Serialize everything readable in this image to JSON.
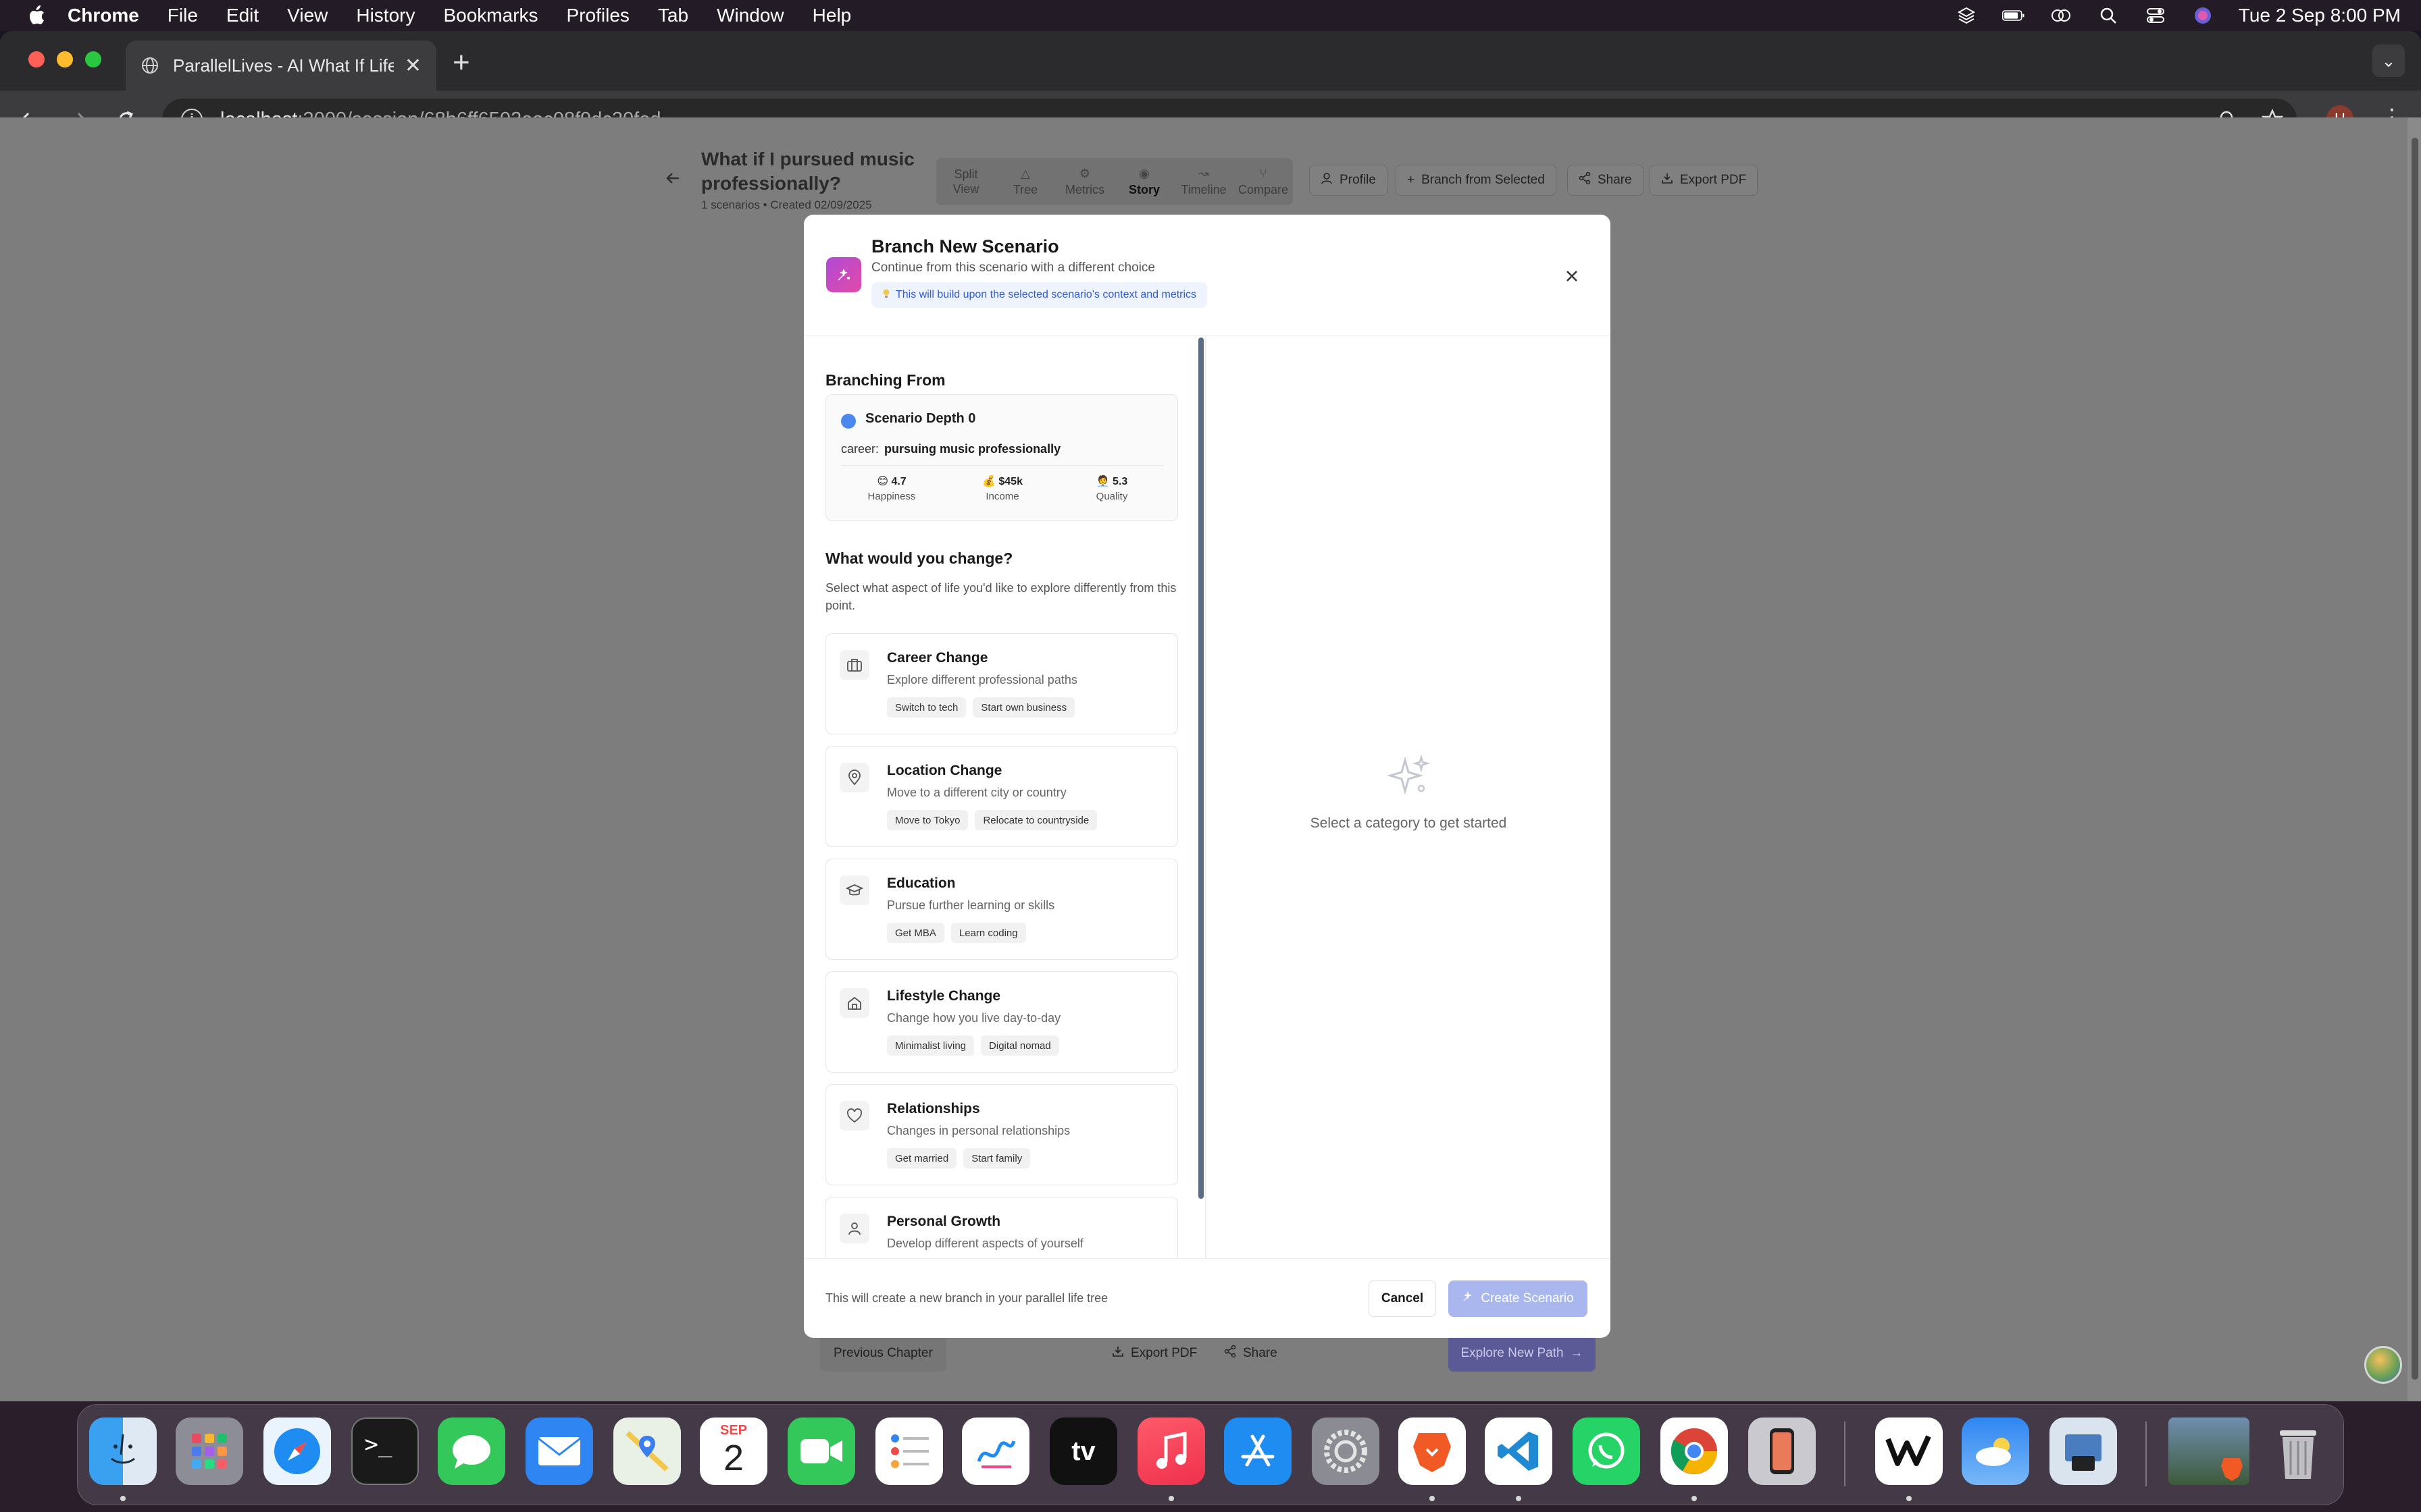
{
  "menubar": {
    "app_name": "Chrome",
    "menus": [
      "File",
      "Edit",
      "View",
      "History",
      "Bookmarks",
      "Profiles",
      "Tab",
      "Window",
      "Help"
    ],
    "datetime": "Tue 2 Sep  8:00 PM"
  },
  "browser": {
    "tab_title": "ParallelLives - AI What If Life",
    "url_host": "localhost",
    "url_path": ":3000/session/68b6ff6502eac08f9dc30fed",
    "profile_initial": "H"
  },
  "page": {
    "title": "What if I pursued music professionally?",
    "subtitle": "1 scenarios • Created 02/09/2025",
    "view_tabs": [
      {
        "line1": "Split",
        "line2": "View",
        "icon": ""
      },
      {
        "line1": "",
        "line2": "Tree",
        "icon": "△"
      },
      {
        "line1": "",
        "line2": "Metrics",
        "icon": "⚙"
      },
      {
        "line1": "",
        "line2": "Story",
        "icon": "◉"
      },
      {
        "line1": "",
        "line2": "Timeline",
        "icon": "↝"
      },
      {
        "line1": "",
        "line2": "Compare",
        "icon": "⑂"
      }
    ],
    "profile_button": "Profile",
    "branch_button": "Branch from Selected",
    "share_button": "Share",
    "export_button": "Export PDF",
    "previous_chapter": "Previous Chapter",
    "bottom_export": "Export PDF",
    "bottom_share": "Share",
    "explore_new_path": "Explore New Path"
  },
  "modal": {
    "title": "Branch New Scenario",
    "subtitle": "Continue from this scenario with a different choice",
    "info_pill": "This will build upon the selected scenario's context and metrics",
    "branching_from_heading": "Branching From",
    "scenario_name": "Scenario Depth 0",
    "scenario_field_label": "career:",
    "scenario_field_value": "pursuing music professionally",
    "metrics": [
      {
        "value": "😊 4.7",
        "label": "Happiness"
      },
      {
        "value": "💰 $45k",
        "label": "Income"
      },
      {
        "value": "🧑‍💼 5.3",
        "label": "Quality"
      }
    ],
    "change_heading": "What would you change?",
    "change_description": "Select what aspect of life you'd like to explore differently from this point.",
    "categories": [
      {
        "name": "Career Change",
        "description": "Explore different professional paths",
        "tags": [
          "Switch to tech",
          "Start own business"
        ],
        "icon": "briefcase-icon"
      },
      {
        "name": "Location Change",
        "description": "Move to a different city or country",
        "tags": [
          "Move to Tokyo",
          "Relocate to countryside"
        ],
        "icon": "map-pin-icon"
      },
      {
        "name": "Education",
        "description": "Pursue further learning or skills",
        "tags": [
          "Get MBA",
          "Learn coding"
        ],
        "icon": "graduation-cap-icon"
      },
      {
        "name": "Lifestyle Change",
        "description": "Change how you live day-to-day",
        "tags": [
          "Minimalist living",
          "Digital nomad"
        ],
        "icon": "home-icon"
      },
      {
        "name": "Relationships",
        "description": "Changes in personal relationships",
        "tags": [
          "Get married",
          "Start family"
        ],
        "icon": "heart-icon"
      },
      {
        "name": "Personal Growth",
        "description": "Develop different aspects of yourself",
        "tags": [],
        "icon": "user-icon"
      }
    ],
    "empty_state": "Select a category to get started",
    "footer_note": "This will create a new branch in your parallel life tree",
    "cancel_label": "Cancel",
    "create_label": "Create Scenario"
  },
  "dock": {
    "calendar_month": "SEP",
    "calendar_day": "2",
    "tv_label": "tv"
  }
}
